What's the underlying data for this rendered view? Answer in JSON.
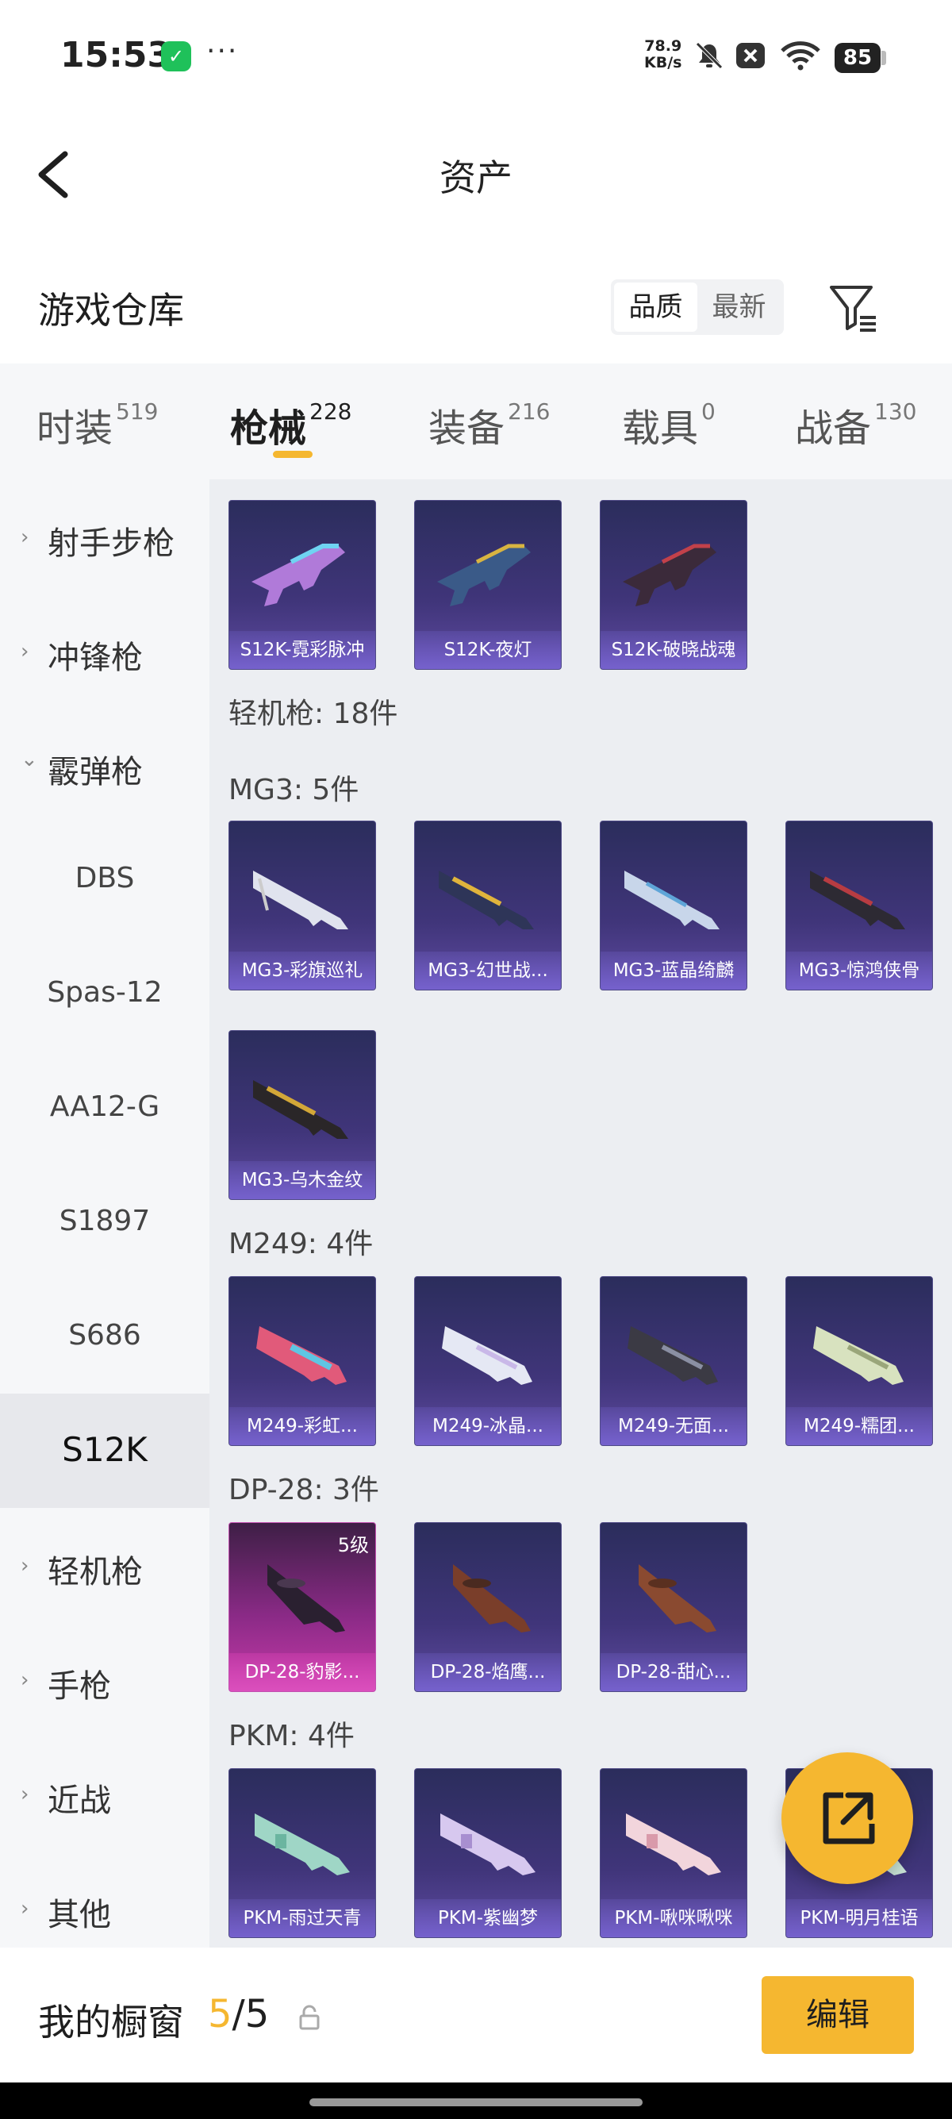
{
  "status_bar": {
    "time": "15:53",
    "speed_value": "78.9",
    "speed_unit": "KB/s",
    "battery": "85",
    "icons": [
      "shield-icon",
      "more-dots-icon",
      "mute-icon",
      "x-icon",
      "wifi-icon",
      "battery-icon"
    ],
    "dots": "···"
  },
  "header": {
    "title": "资产"
  },
  "warehouse": {
    "title": "游戏仓库",
    "sort_quality": "品质",
    "sort_newest": "最新"
  },
  "tabs": [
    {
      "label": "时装",
      "count": "519"
    },
    {
      "label": "枪械",
      "count": "228"
    },
    {
      "label": "装备",
      "count": "216"
    },
    {
      "label": "载具",
      "count": "0"
    },
    {
      "label": "战备",
      "count": "130"
    }
  ],
  "sidebar": {
    "categories": [
      {
        "label": "射手步枪",
        "chevron": "›"
      },
      {
        "label": "冲锋枪",
        "chevron": "›"
      },
      {
        "label": "霰弹枪",
        "chevron": "⌄"
      },
      {
        "label": "轻机枪",
        "chevron": "›"
      },
      {
        "label": "手枪",
        "chevron": "›"
      },
      {
        "label": "近战",
        "chevron": "›"
      },
      {
        "label": "其他",
        "chevron": "›"
      }
    ],
    "subitems": [
      {
        "label": "DBS"
      },
      {
        "label": "Spas-12"
      },
      {
        "label": "AA12-G"
      },
      {
        "label": "S1897"
      },
      {
        "label": "S686"
      },
      {
        "label": "S12K"
      }
    ]
  },
  "groups": {
    "s12k_items": [
      {
        "name": "S12K-霓彩脉冲"
      },
      {
        "name": "S12K-夜灯"
      },
      {
        "name": "S12K-破晓战魂"
      }
    ],
    "lmg_label": "轻机枪: 18件",
    "mg3_label": "MG3: 5件",
    "mg3_items": [
      {
        "name": "MG3-彩旗巡礼"
      },
      {
        "name": "MG3-幻世战..."
      },
      {
        "name": "MG3-蓝晶绮麟"
      },
      {
        "name": "MG3-惊鸿侠骨"
      },
      {
        "name": "MG3-乌木金纹"
      }
    ],
    "m249_label": "M249: 4件",
    "m249_items": [
      {
        "name": "M249-彩虹..."
      },
      {
        "name": "M249-冰晶..."
      },
      {
        "name": "M249-无面..."
      },
      {
        "name": "M249-糯团..."
      }
    ],
    "dp28_label": "DP-28: 3件",
    "dp28_items": [
      {
        "name": "DP-28-豹影...",
        "level": "5级"
      },
      {
        "name": "DP-28-焰鹰..."
      },
      {
        "name": "DP-28-甜心..."
      }
    ],
    "pkm_label": "PKM: 4件",
    "pkm_items": [
      {
        "name": "PKM-雨过天青"
      },
      {
        "name": "PKM-紫幽梦"
      },
      {
        "name": "PKM-啾咪啾咪"
      },
      {
        "name": "PKM-明月桂语"
      }
    ]
  },
  "bottom_bar": {
    "label": "我的橱窗",
    "current": "5",
    "separator": "/",
    "total": "5",
    "edit_label": "编辑"
  },
  "colors": {
    "accent": "#f5b730",
    "card_bg": "#40357a",
    "card_gold": "#c63aa8"
  }
}
